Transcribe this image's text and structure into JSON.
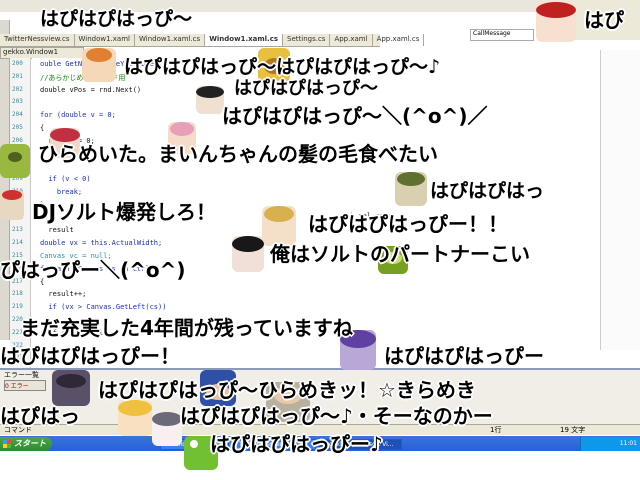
{
  "editor": {
    "tabs": [
      "TwitterNessview.cs",
      "Window1.xaml",
      "Window1.xaml.cs",
      "Window1.xaml.cs",
      "Settings.cs",
      "App.xaml",
      "App.xaml.cs"
    ],
    "active_tab": 3,
    "subtab": "gekko.Window1",
    "right_label": "CallMessage",
    "line_numbers": [
      "200",
      "201",
      "202",
      "203",
      "204",
      "205",
      "206",
      "207",
      "208",
      "209",
      "210",
      "211",
      "212",
      "213",
      "214",
      "215",
      "216",
      "217",
      "218",
      "219",
      "220",
      "221",
      "222",
      "223"
    ],
    "code_lines": [
      {
        "text": "ouble GetNewMessageY(double y)",
        "cls": "blue"
      },
      {
        "text": "//あらかじめ補正モード用",
        "cls": "green"
      },
      {
        "text": "double vPos = rnd.Next()",
        "cls": ""
      },
      {
        "text": "",
        "cls": ""
      },
      {
        "text": "for (double v = 0;",
        "cls": "blue"
      },
      {
        "text": "{",
        "cls": ""
      },
      {
        "text": "  result = 0;",
        "cls": ""
      },
      {
        "text": "",
        "cls": ""
      },
      {
        "text": "",
        "cls": ""
      },
      {
        "text": "  if (v < 0)",
        "cls": "blue"
      },
      {
        "text": "    break;",
        "cls": "blue"
      },
      {
        "text": "}",
        "cls": ""
      },
      {
        "text": "",
        "cls": ""
      },
      {
        "text": "  result",
        "cls": ""
      },
      {
        "text": "double vx = this.ActualWidth;",
        "cls": "blue"
      },
      {
        "text": "Canvas vc = null;",
        "cls": "teal"
      },
      {
        "text": "foreach (Canvas cs in ctrls)",
        "cls": "blue"
      },
      {
        "text": "{",
        "cls": ""
      },
      {
        "text": "  result++;",
        "cls": ""
      },
      {
        "text": "  if (vx > Canvas.GetLeft(cs))",
        "cls": "blue"
      },
      {
        "text": "",
        "cls": ""
      },
      {
        "text": "  if (vc = null)",
        "cls": "blue"
      },
      {
        "text": "",
        "cls": ""
      },
      {
        "text": "}",
        "cls": ""
      }
    ],
    "code_tail": ") sel    sol;"
  },
  "bottom_panel": {
    "title": "エラー一覧",
    "button": "0 エラー"
  },
  "statusbar": {
    "left": "コマンド",
    "col": "1行",
    "chars": "19 文字"
  },
  "taskbar": {
    "start": "スタート",
    "items": [
      "",
      "",
      "",
      "Windows...",
      "Twitter Messenger...",
      "gekko - Microsoft Vi..."
    ],
    "clock": "11:01"
  },
  "comments": [
    {
      "text": "はぴはぴはっぴ～",
      "size": 20
    },
    {
      "text": "はぴ",
      "size": 20
    },
    {
      "text": "はぴはぴはっぴ～はぴはぴはっぴ～♪",
      "size": 20
    },
    {
      "text": "はぴはぴはっぴ～＼(^o^)／",
      "size": 20
    },
    {
      "text": "はぴはぴはっぴ～",
      "size": 20
    },
    {
      "text": "ひらめいた。まいんちゃんの髪の毛食べたい",
      "size": 20
    },
    {
      "text": "DJソルト爆発しろ！",
      "size": 20
    },
    {
      "text": "はぴはぴはっ",
      "size": 18
    },
    {
      "text": "はぴはぴはっぴー！！",
      "size": 20
    },
    {
      "text": "俺はソルトのパートナーこい",
      "size": 20
    },
    {
      "text": "ぴはっぴー＼(^o^)",
      "size": 20
    },
    {
      "text": "まだ充実した4年間が残っていますね",
      "size": 20
    },
    {
      "text": "はぴはぴはっぴー！",
      "size": 20
    },
    {
      "text": "はぴはぴはっぴー",
      "size": 20
    },
    {
      "text": "はぴはぴはっぴ〜ひらめきッ！☆きらめき",
      "size": 20
    },
    {
      "text": "はぴはっ",
      "size": 20
    },
    {
      "text": "はぴはぴはっぴ～♪・そーなのかー",
      "size": 20
    },
    {
      "text": "はぴはぴはっぴー♪",
      "size": 20
    }
  ]
}
